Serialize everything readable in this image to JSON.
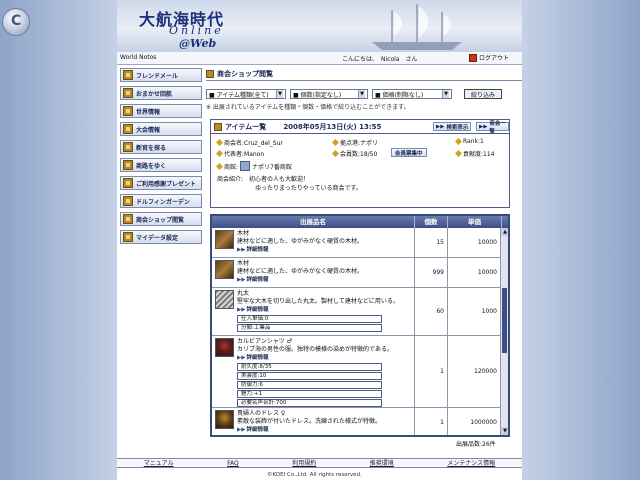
{
  "banner": {
    "title": "大航海時代",
    "subtitle": "Online",
    "web": "@Web"
  },
  "topbar": {
    "site_name": "World Notos",
    "greeting": "こんにちは、　Nicola　さん",
    "logout": "ログアウト"
  },
  "nav": {
    "items": [
      {
        "label": "フレンドメール"
      },
      {
        "label": "おまかせ回航"
      },
      {
        "label": "世界情報"
      },
      {
        "label": "大会情報"
      },
      {
        "label": "新官を探る"
      },
      {
        "label": "商路をゆく"
      },
      {
        "label": "ご利用感謝プレゼント"
      },
      {
        "label": "ドルフィンガーデン"
      },
      {
        "label": "商会ショップ閲覧"
      },
      {
        "label": "マイデータ設定"
      }
    ]
  },
  "main": {
    "section_title": "商会ショップ閲覧",
    "filters": {
      "item_type": "■ アイテム種類(全て)",
      "count": "■ 個数(指定なし)",
      "price": "■ 価格(制限なし)",
      "submit": "絞り込み"
    },
    "note": "※ 出展されているアイテムを種類・個数・価格で絞り込むことができます。",
    "list": {
      "title": "アイテム一覧",
      "datetime": "2008年05月13日(火) 13:55",
      "btn_search": "検索表示",
      "btn_shop": "商会一覧"
    },
    "shop": {
      "name": "商会名:Cruz_del_Sur",
      "base": "拠点港:ナポリ",
      "rank": "Rank:1",
      "rep": "代表者:Manon",
      "members": "会員数:18/50",
      "member_btn": "会員票集中",
      "contrib": "貢献度:114",
      "location": "商館:",
      "location_val": "ナポリ7番商館",
      "intro_label": "商会紹介:",
      "intro_line1": "初心者の人も大歓迎！",
      "intro_line2": "ゆったりまったりやっている商会です。"
    },
    "table": {
      "headers": {
        "name": "出展品名",
        "count": "個数",
        "price": "単価"
      },
      "rows": [
        {
          "name": "木材",
          "desc": "建材などに適した、ゆがみがなく硬質の木材。",
          "detail": "詳細情報",
          "count": "15",
          "price": "10000"
        },
        {
          "name": "木材",
          "desc": "建材などに適した、ゆがみがなく硬質の木材。",
          "detail": "詳細情報",
          "count": "999",
          "price": "10000"
        },
        {
          "name": "丸太",
          "desc": "堅牢な大木を切り出した丸太。製材して建材などに用いる。",
          "detail": "詳細情報",
          "count": "60",
          "price": "1000",
          "attrs": [
            "仕入単価:0",
            "分類:工業品"
          ]
        },
        {
          "name": "カルビアンシャツ ♂",
          "desc": "カリブ海の男性の服。独特の模様の染めが特徴的である。",
          "detail": "詳細情報",
          "count": "1",
          "price": "120000",
          "attrs": [
            "耐久度:8/35",
            "実装度:10",
            "防御力:6",
            "魅力:+1",
            "必要名声合計:700"
          ]
        },
        {
          "name": "貴婦人のドレス ♀",
          "desc": "素敵な装飾が付いたドレス。洗練された様式が特徴。",
          "detail": "詳細情報",
          "count": "1",
          "price": "1000000"
        }
      ],
      "total": "出展品数:26件"
    }
  },
  "footer": {
    "links": [
      "マニュアル",
      "FAQ",
      "利用規約",
      "推奨環境",
      "メンテナンス情報"
    ],
    "copyright": "©KOEI Co.,Ltd. All rights reserved."
  },
  "colors": {
    "accent": "#3d4e84",
    "nav_border": "#7b8bb0",
    "icon_gold": "#b58a2a"
  }
}
